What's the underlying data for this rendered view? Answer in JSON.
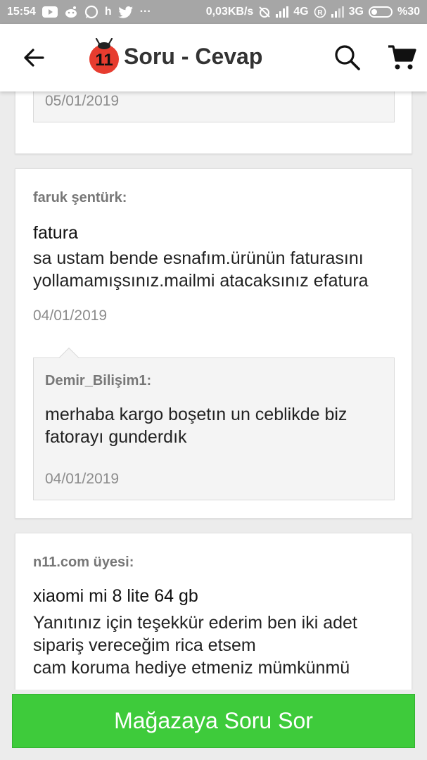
{
  "status_bar": {
    "time": "15:54",
    "icons_left": [
      "youtube-icon",
      "reddit-icon",
      "whatsapp-icon",
      "h-icon",
      "twitter-icon",
      "more-icon"
    ],
    "h_letter": "h",
    "dots": "···",
    "speed": "0,03KB/s",
    "net1": "4G",
    "net2": "3G",
    "battery": "%30",
    "color": "#a6a6a6"
  },
  "app_bar": {
    "title": "Soru - Cevap",
    "back_icon": "arrow-left-icon",
    "search_icon": "search-icon",
    "cart_icon": "cart-icon",
    "logo_text": "11",
    "logo_color": "#e73c2f"
  },
  "questions": [
    {
      "reply": {
        "date": "05/01/2019"
      }
    },
    {
      "author": "faruk şentürk:",
      "subject": "fatura",
      "body": [
        "sa ustam bende esnafım.ürünün faturasını",
        "yollamamışsınız.mailmi atacaksınız efatura"
      ],
      "date": "04/01/2019",
      "reply": {
        "author": "Demir_Bilişim1:",
        "body": [
          "merhaba kargo boşetın un ceblikde biz",
          "fatorayı gunderdık"
        ],
        "date": "04/01/2019"
      }
    },
    {
      "author": "n11.com üyesi:",
      "subject": "xiaomi mi 8 lite 64 gb",
      "body": [
        "Yanıtınız için teşekkür ederim ben iki adet",
        "sipariş vereceğim rica etsem",
        "cam koruma hediye etmeniz mümkünmü"
      ]
    }
  ],
  "ask_button": {
    "label": "Mağazaya Soru Sor",
    "color": "#3ecb3b"
  }
}
